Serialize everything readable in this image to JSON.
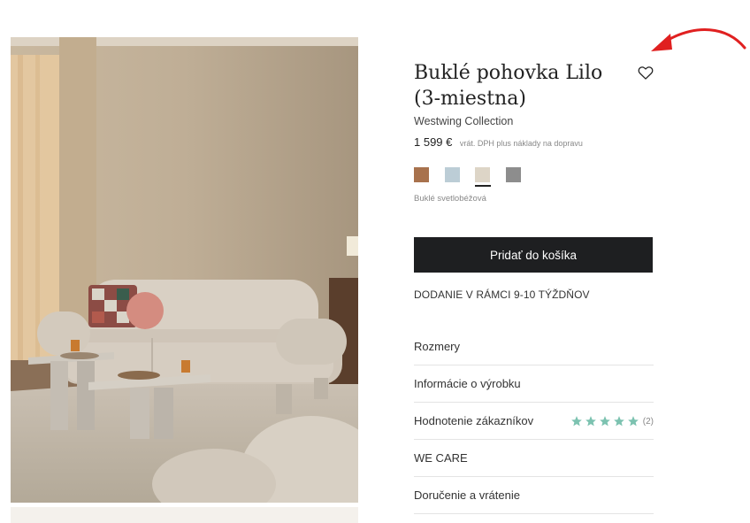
{
  "product": {
    "title": "Buklé pohovka Lilo (3-miestna)",
    "brand": "Westwing Collection",
    "price": "1 599 €",
    "price_note": "vrát. DPH plus náklady na dopravu",
    "selected_color_label": "Buklé svetlobéžová"
  },
  "swatches": [
    {
      "color": "#a8724d",
      "selected": false
    },
    {
      "color": "#bccdd6",
      "selected": false
    },
    {
      "color": "#ddd5c7",
      "selected": true
    },
    {
      "color": "#8d8d8d",
      "selected": false
    }
  ],
  "cart": {
    "label": "Pridať do košíka"
  },
  "delivery": {
    "text": "DODANIE V RÁMCI 9-10 TÝŽDŇOV"
  },
  "accordion": [
    {
      "label": "Rozmery"
    },
    {
      "label": "Informácie o výrobku"
    },
    {
      "label": "Hodnotenie zákazníkov",
      "rating": 5,
      "count": "(2)"
    },
    {
      "label": "WE CARE"
    },
    {
      "label": "Doručenie a vrátenie"
    }
  ],
  "colors": {
    "accent_dark": "#1e1f21",
    "star": "#7cc2b0",
    "annotation_arrow": "#e02020"
  }
}
